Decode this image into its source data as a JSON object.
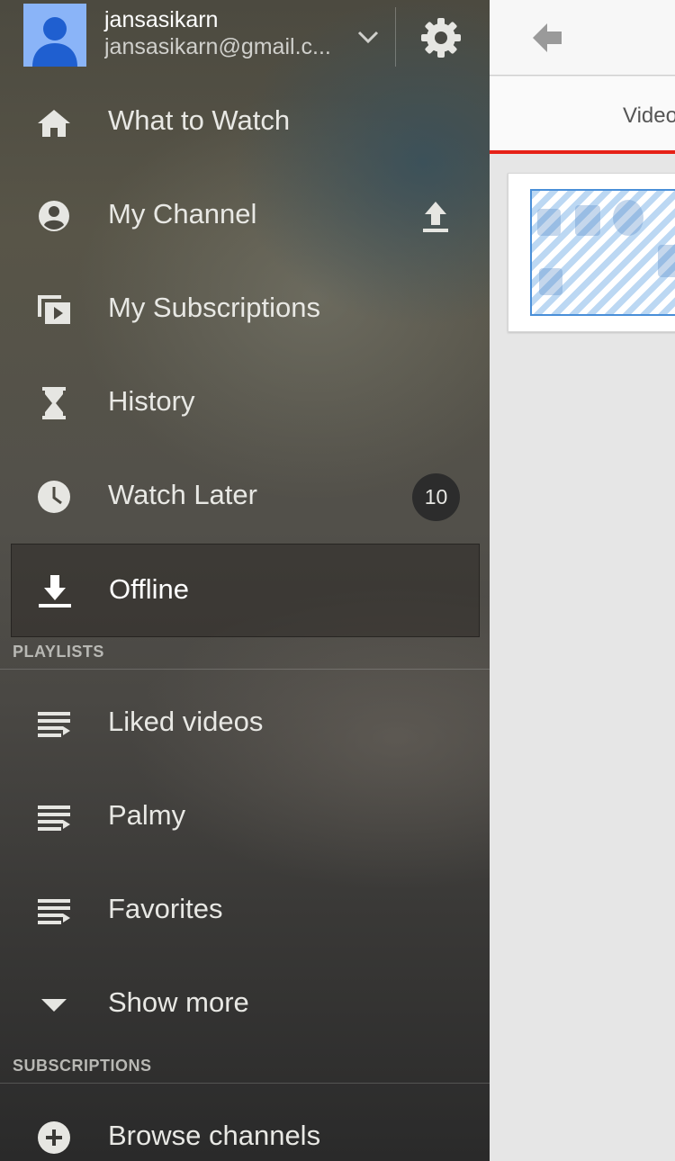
{
  "account": {
    "name": "jansasikarn",
    "email": "jansasikarn@gmail.c..."
  },
  "menu": [
    {
      "label": "What to Watch",
      "icon": "home-icon"
    },
    {
      "label": "My Channel",
      "icon": "account-circle-icon"
    },
    {
      "label": "My Subscriptions",
      "icon": "subscriptions-icon"
    },
    {
      "label": "History",
      "icon": "hourglass-icon"
    },
    {
      "label": "Watch Later",
      "icon": "clock-icon",
      "badge": "10"
    },
    {
      "label": "Offline",
      "icon": "download-icon",
      "selected": true
    }
  ],
  "playlists": {
    "header": "PLAYLISTS",
    "items": [
      {
        "label": "Liked videos",
        "icon": "playlist-icon"
      },
      {
        "label": "Palmy",
        "icon": "playlist-icon"
      },
      {
        "label": "Favorites",
        "icon": "playlist-icon"
      },
      {
        "label": "Show more",
        "icon": "caret-down-icon"
      }
    ]
  },
  "subscriptions": {
    "header": "SUBSCRIPTIONS",
    "items": [
      {
        "label": "Browse channels",
        "icon": "add-circle-icon"
      }
    ]
  },
  "content": {
    "tab_label": "Videos"
  },
  "colors": {
    "accent": "#e62117",
    "avatar_bg": "#8ab4f8"
  }
}
